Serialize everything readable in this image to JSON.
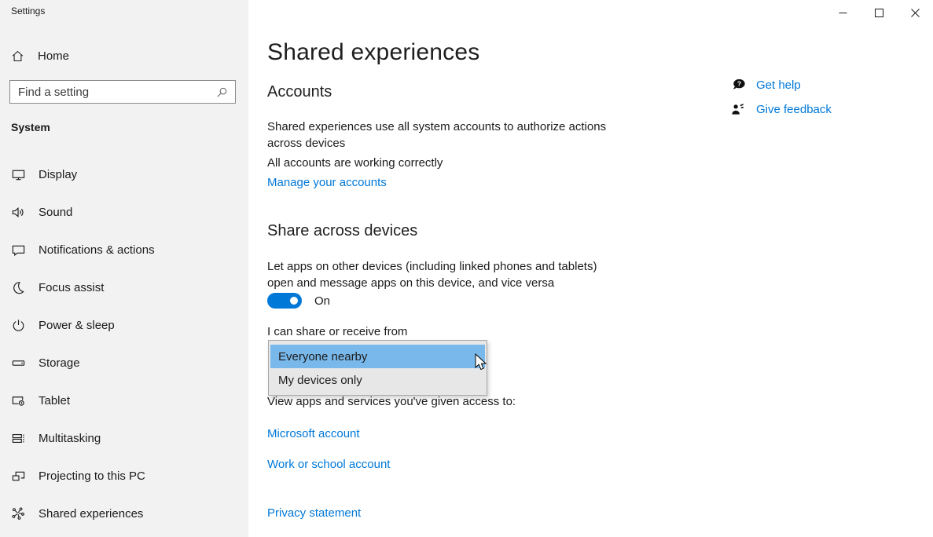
{
  "window": {
    "title": "Settings",
    "controls": {
      "minimize": "minimize",
      "maximize": "maximize",
      "close": "close"
    }
  },
  "sidebar": {
    "home_label": "Home",
    "search_placeholder": "Find a setting",
    "section_header": "System",
    "nav": [
      {
        "label": "Display",
        "icon": "display-icon"
      },
      {
        "label": "Sound",
        "icon": "sound-icon"
      },
      {
        "label": "Notifications & actions",
        "icon": "notifications-icon"
      },
      {
        "label": "Focus assist",
        "icon": "focus-assist-icon"
      },
      {
        "label": "Power & sleep",
        "icon": "power-icon"
      },
      {
        "label": "Storage",
        "icon": "storage-icon"
      },
      {
        "label": "Tablet",
        "icon": "tablet-icon"
      },
      {
        "label": "Multitasking",
        "icon": "multitasking-icon"
      },
      {
        "label": "Projecting to this PC",
        "icon": "projecting-icon"
      },
      {
        "label": "Shared experiences",
        "icon": "shared-experiences-icon"
      }
    ]
  },
  "main": {
    "title": "Shared experiences",
    "accounts": {
      "heading": "Accounts",
      "description": "Shared experiences use all system accounts to authorize actions across devices",
      "status": "All accounts are working correctly",
      "manage_link": "Manage your accounts"
    },
    "share_across_devices": {
      "heading": "Share across devices",
      "description": "Let apps on other devices (including linked phones and tablets) open and message apps on this device, and vice versa",
      "toggle_state": "On",
      "share_from_label": "I can share or receive from",
      "dropdown": {
        "options": [
          {
            "label": "Everyone nearby",
            "selected": true
          },
          {
            "label": "My devices only",
            "selected": false
          }
        ]
      },
      "view_access_text": "View apps and services you've given access to:",
      "account_links": [
        "Microsoft account",
        "Work or school account"
      ]
    },
    "privacy_link": "Privacy statement"
  },
  "help_panel": {
    "get_help": "Get help",
    "give_feedback": "Give feedback"
  },
  "colors": {
    "accent": "#0078d7",
    "link": "#0078d7",
    "dropdown_highlight": "#79b8ea",
    "sidebar_bg": "#f2f2f2",
    "dropdown_bg": "#e7e7e7"
  }
}
